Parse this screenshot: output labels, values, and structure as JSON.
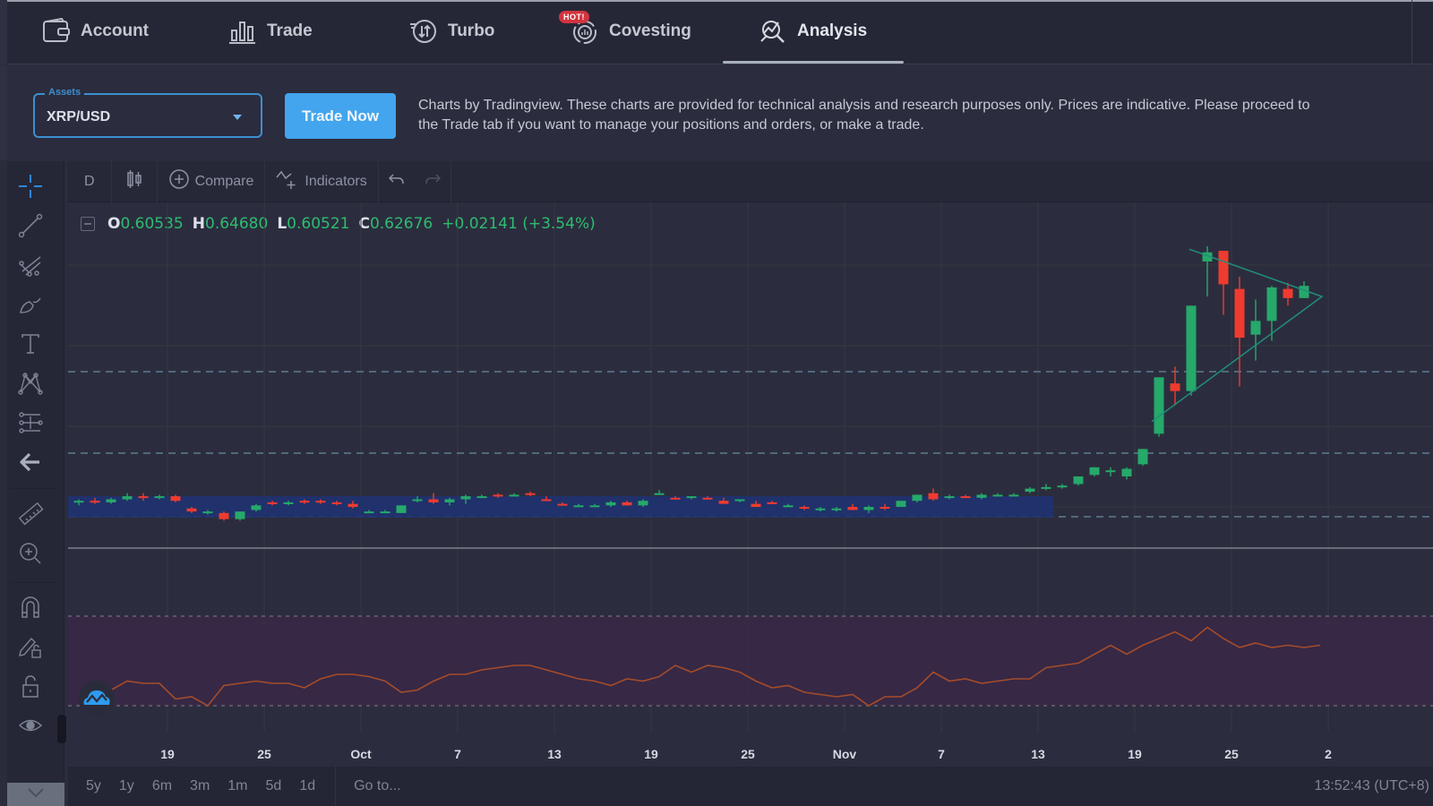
{
  "nav": {
    "tabs": [
      {
        "label": "Account",
        "icon": "wallet-icon"
      },
      {
        "label": "Trade",
        "icon": "bar-chart-icon"
      },
      {
        "label": "Turbo",
        "icon": "turbo-arrows-icon"
      },
      {
        "label": "Covesting",
        "icon": "covesting-icon",
        "badge": "HOT!"
      },
      {
        "label": "Analysis",
        "icon": "analysis-icon",
        "active": true
      }
    ]
  },
  "assets": {
    "label": "Assets",
    "value": "XRP/USD"
  },
  "trade_button": "Trade Now",
  "disclaimer": "Charts by Tradingview. These charts are provided for technical analysis and research purposes only. Prices are indicative. Please proceed to the Trade tab if you want to manage your positions and orders, or make a trade.",
  "chart_toolbar": {
    "interval": "D",
    "chart_type_icon": "candles-icon",
    "compare": "Compare",
    "indicators": "Indicators"
  },
  "left_tools": [
    "crosshair-icon",
    "trend-line-icon",
    "pitchfork-icon",
    "brush-icon",
    "text-icon",
    "pattern-icon",
    "prediction-icon",
    "back-arrow-icon",
    "ruler-icon",
    "zoom-in-icon",
    "magnet-icon",
    "lock-drawings-icon",
    "lock-icon",
    "eye-icon"
  ],
  "ohlc": {
    "o_key": "O",
    "o": "0.60535",
    "h_key": "H",
    "h": "0.64680",
    "l_key": "L",
    "l": "0.60521",
    "c_key": "C",
    "c": "0.62676",
    "change": "+0.02141 (+3.54%)"
  },
  "time_ranges": [
    "5y",
    "1y",
    "6m",
    "3m",
    "1m",
    "5d",
    "1d"
  ],
  "goto": "Go to...",
  "clock": "13:52:43 (UTC+8)",
  "colors": {
    "up": "#26a96a",
    "down": "#ef3b2f",
    "accent": "#42a5ee",
    "rsi_line": "#a54c2a",
    "range_box": "#1f3270"
  },
  "chart_data": {
    "type": "candlestick",
    "interval": "D",
    "symbol": "XRP/USD",
    "x_tick_labels": [
      "19",
      "25",
      "Oct",
      "7",
      "13",
      "19",
      "25",
      "Nov",
      "7",
      "13",
      "19",
      "25",
      "2"
    ],
    "price_series_note": "relative price levels, estimated (arbitrary units, higher = higher price)",
    "candles": [
      [
        0.52,
        0.522,
        0.518,
        0.521
      ],
      [
        0.521,
        0.523,
        0.519,
        0.52
      ],
      [
        0.52,
        0.523,
        0.519,
        0.522
      ],
      [
        0.522,
        0.526,
        0.521,
        0.524
      ],
      [
        0.524,
        0.526,
        0.521,
        0.523
      ],
      [
        0.523,
        0.525,
        0.522,
        0.524
      ],
      [
        0.524,
        0.525,
        0.52,
        0.521
      ],
      [
        0.516,
        0.517,
        0.513,
        0.514
      ],
      [
        0.513,
        0.515,
        0.512,
        0.514
      ],
      [
        0.513,
        0.514,
        0.508,
        0.509
      ],
      [
        0.509,
        0.514,
        0.508,
        0.514
      ],
      [
        0.515,
        0.519,
        0.514,
        0.518
      ],
      [
        0.52,
        0.521,
        0.518,
        0.519
      ],
      [
        0.519,
        0.521,
        0.518,
        0.52
      ],
      [
        0.521,
        0.522,
        0.519,
        0.52
      ],
      [
        0.521,
        0.522,
        0.519,
        0.52
      ],
      [
        0.52,
        0.521,
        0.518,
        0.519
      ],
      [
        0.519,
        0.521,
        0.516,
        0.517
      ],
      [
        0.514,
        0.515,
        0.513,
        0.514
      ],
      [
        0.514,
        0.515,
        0.513,
        0.514
      ],
      [
        0.513,
        0.518,
        0.513,
        0.518
      ],
      [
        0.521,
        0.524,
        0.52,
        0.522
      ],
      [
        0.522,
        0.526,
        0.519,
        0.52
      ],
      [
        0.52,
        0.523,
        0.518,
        0.522
      ],
      [
        0.522,
        0.525,
        0.519,
        0.524
      ],
      [
        0.524,
        0.525,
        0.523,
        0.524
      ],
      [
        0.525,
        0.526,
        0.523,
        0.524
      ],
      [
        0.525,
        0.526,
        0.524,
        0.525
      ],
      [
        0.526,
        0.527,
        0.524,
        0.525
      ],
      [
        0.522,
        0.524,
        0.521,
        0.521
      ],
      [
        0.519,
        0.52,
        0.518,
        0.518
      ],
      [
        0.518,
        0.519,
        0.517,
        0.518
      ],
      [
        0.518,
        0.519,
        0.518,
        0.518
      ],
      [
        0.518,
        0.521,
        0.517,
        0.52
      ],
      [
        0.52,
        0.521,
        0.518,
        0.518
      ],
      [
        0.518,
        0.522,
        0.517,
        0.521
      ],
      [
        0.526,
        0.528,
        0.525,
        0.526
      ],
      [
        0.523,
        0.524,
        0.522,
        0.522
      ],
      [
        0.523,
        0.524,
        0.522,
        0.524
      ],
      [
        0.523,
        0.524,
        0.522,
        0.522
      ],
      [
        0.521,
        0.523,
        0.52,
        0.519
      ],
      [
        0.521,
        0.522,
        0.52,
        0.522
      ],
      [
        0.519,
        0.521,
        0.518,
        0.517
      ],
      [
        0.52,
        0.521,
        0.519,
        0.519
      ],
      [
        0.518,
        0.519,
        0.517,
        0.518
      ],
      [
        0.517,
        0.518,
        0.515,
        0.516
      ],
      [
        0.516,
        0.517,
        0.514,
        0.516
      ],
      [
        0.516,
        0.517,
        0.514,
        0.516
      ],
      [
        0.517,
        0.519,
        0.515,
        0.515
      ],
      [
        0.515,
        0.518,
        0.513,
        0.517
      ],
      [
        0.517,
        0.519,
        0.515,
        0.516
      ],
      [
        0.517,
        0.521,
        0.517,
        0.521
      ],
      [
        0.521,
        0.525,
        0.52,
        0.525
      ],
      [
        0.526,
        0.529,
        0.521,
        0.522
      ],
      [
        0.523,
        0.525,
        0.522,
        0.524
      ],
      [
        0.524,
        0.525,
        0.523,
        0.523
      ],
      [
        0.523,
        0.526,
        0.522,
        0.525
      ],
      [
        0.525,
        0.526,
        0.524,
        0.525
      ],
      [
        0.525,
        0.526,
        0.524,
        0.525
      ],
      [
        0.527,
        0.53,
        0.526,
        0.529
      ],
      [
        0.529,
        0.532,
        0.528,
        0.53
      ],
      [
        0.53,
        0.532,
        0.529,
        0.531
      ],
      [
        0.532,
        0.537,
        0.531,
        0.537
      ],
      [
        0.538,
        0.543,
        0.537,
        0.543
      ],
      [
        0.541,
        0.543,
        0.537,
        0.541
      ],
      [
        0.537,
        0.543,
        0.535,
        0.542
      ],
      [
        0.545,
        0.555,
        0.544,
        0.555
      ],
      [
        0.565,
        0.602,
        0.563,
        0.602
      ],
      [
        0.598,
        0.609,
        0.584,
        0.593
      ],
      [
        0.593,
        0.649,
        0.59,
        0.649
      ],
      [
        0.678,
        0.688,
        0.655,
        0.684
      ],
      [
        0.685,
        0.68,
        0.643,
        0.663
      ],
      [
        0.66,
        0.668,
        0.596,
        0.628
      ],
      [
        0.63,
        0.653,
        0.613,
        0.639
      ],
      [
        0.639,
        0.662,
        0.626,
        0.661
      ],
      [
        0.66,
        0.664,
        0.649,
        0.654
      ],
      [
        0.654,
        0.665,
        0.654,
        0.662
      ]
    ],
    "horizontal_levels_dashed": 3,
    "annotations": [
      "range box (consolidation zone)",
      "symmetrical triangle pattern"
    ],
    "rsi": {
      "series": [
        37,
        41,
        40,
        40,
        33,
        34,
        30,
        39,
        40,
        41,
        40,
        40,
        38,
        42,
        44,
        44,
        43,
        41,
        36,
        37,
        41,
        44,
        44,
        46,
        47,
        48,
        48,
        46,
        44,
        42,
        41,
        39,
        42,
        41,
        43,
        48,
        45,
        48,
        47,
        45,
        41,
        38,
        39,
        36,
        35,
        34,
        35,
        30,
        34,
        34,
        38,
        45,
        41,
        42,
        40,
        41,
        42,
        42,
        47,
        48,
        49,
        53,
        57,
        53,
        57,
        60,
        63,
        59,
        65,
        60,
        56,
        58,
        56,
        57,
        56,
        57
      ]
    }
  }
}
